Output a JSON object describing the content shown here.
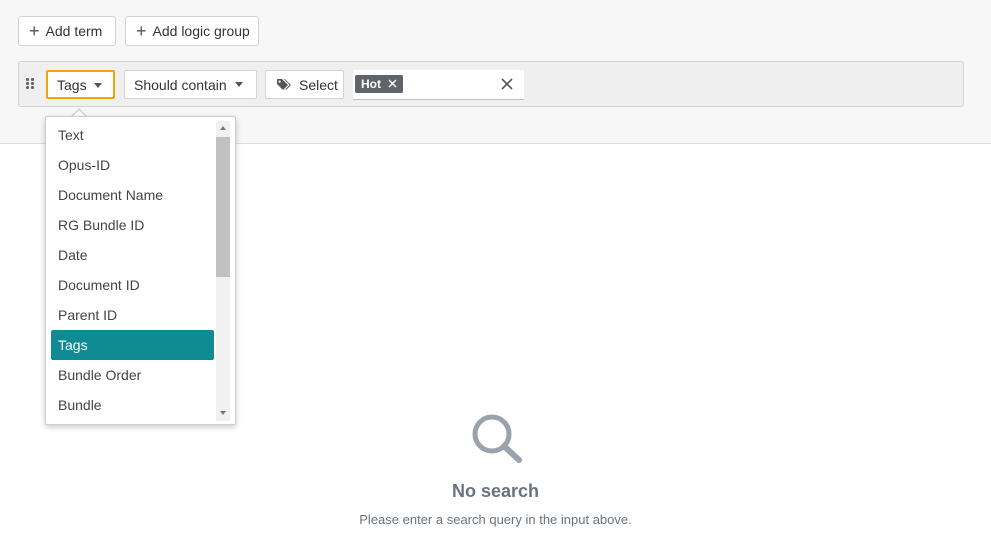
{
  "toolbar": {
    "add_term_label": "Add term",
    "add_logic_group_label": "Add logic group"
  },
  "term": {
    "field_value": "Tags",
    "operator_value": "Should contain",
    "select_label": "Select",
    "chips": [
      {
        "label": "Hot"
      }
    ]
  },
  "field_dropdown": {
    "options": [
      "Text",
      "Opus-ID",
      "Document Name",
      "RG Bundle ID",
      "Date",
      "Document ID",
      "Parent ID",
      "Tags",
      "Bundle Order",
      "Bundle"
    ],
    "selected": "Tags"
  },
  "empty_state": {
    "title": "No search",
    "message": "Please enter a search query in the input above.",
    "icon": "search-icon"
  },
  "colors": {
    "accent": "#0e8b93",
    "focus_outline": "#f0a30a",
    "chip_bg": "#5f656b"
  }
}
